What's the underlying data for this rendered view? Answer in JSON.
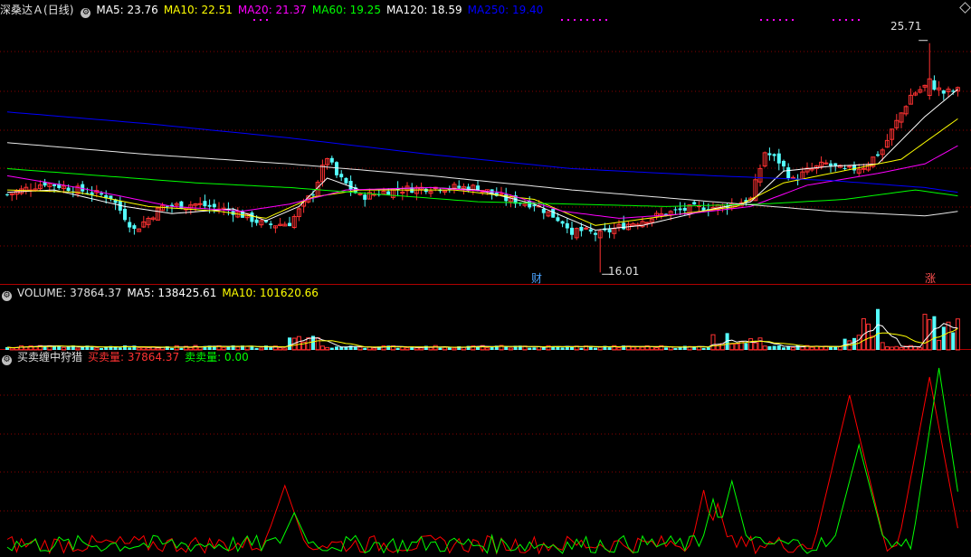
{
  "main_panel": {
    "stock_name": "深桑达Ａ",
    "period": "(日线)",
    "ma_legend": [
      {
        "text": "MA5: 23.76",
        "color": "#ffffff"
      },
      {
        "text": "MA10: 22.51",
        "color": "#ffff00"
      },
      {
        "text": "MA20: 21.37",
        "color": "#ff00ff"
      },
      {
        "text": "MA60: 19.25",
        "color": "#00ff00"
      },
      {
        "text": "MA120: 18.59",
        "color": "#ffffff"
      },
      {
        "text": "MA250: 19.40",
        "color": "#0000ff"
      }
    ],
    "high_label": "25.71",
    "low_label": "16.01",
    "marker_cai": "财",
    "marker_zhang": "涨"
  },
  "volume_panel": {
    "title": "VOLUME: 37864.37",
    "ma5": "MA5: 138425.61",
    "ma10": "MA10: 101620.66"
  },
  "indicator_panel": {
    "title": "买卖缠中狩猎",
    "buy": "买卖量: 37864.37",
    "sell": "卖卖量: 0.00"
  },
  "colors": {
    "up": "#ff3232",
    "down": "#54ffff",
    "ma5": "#ffffff",
    "ma10": "#ffff00",
    "ma20": "#ff00ff",
    "ma60": "#00ff00",
    "ma120": "#e8e8e8",
    "ma250": "#0000ff",
    "grid": "#8b0000",
    "buy_line": "#ff0000",
    "sell_line": "#00ff00"
  },
  "chart_data": [
    {
      "type": "candlestick",
      "title": "深桑达Ａ (日线)",
      "ylim": [
        15.6,
        27.0
      ],
      "high": 25.71,
      "low": 16.01,
      "anchors": [
        [
          0,
          19.3
        ],
        [
          8,
          19.8
        ],
        [
          15,
          19.5
        ],
        [
          22,
          19.2
        ],
        [
          27,
          17.8
        ],
        [
          33,
          18.8
        ],
        [
          40,
          18.9
        ],
        [
          48,
          18.6
        ],
        [
          55,
          18.0
        ],
        [
          60,
          18.1
        ],
        [
          65,
          19.4
        ],
        [
          68,
          20.9
        ],
        [
          70,
          20.1
        ],
        [
          75,
          19.2
        ],
        [
          82,
          19.5
        ],
        [
          90,
          19.6
        ],
        [
          100,
          19.6
        ],
        [
          106,
          19.1
        ],
        [
          112,
          18.9
        ],
        [
          116,
          18.4
        ],
        [
          121,
          17.8
        ],
        [
          126,
          17.6
        ],
        [
          131,
          18.0
        ],
        [
          140,
          18.5
        ],
        [
          145,
          18.7
        ],
        [
          152,
          18.8
        ],
        [
          158,
          19.1
        ],
        [
          161,
          21.1
        ],
        [
          164,
          20.7
        ],
        [
          167,
          19.9
        ],
        [
          170,
          20.3
        ],
        [
          174,
          20.6
        ],
        [
          178,
          20.3
        ],
        [
          182,
          20.5
        ],
        [
          186,
          21.2
        ],
        [
          188,
          22.0
        ],
        [
          192,
          23.5
        ],
        [
          196,
          24.0
        ],
        [
          199,
          23.6
        ],
        [
          202,
          23.7
        ]
      ],
      "ma_anchors": {
        "MA5": [
          [
            0,
            19.4
          ],
          [
            10,
            19.5
          ],
          [
            25,
            18.8
          ],
          [
            35,
            18.5
          ],
          [
            48,
            18.7
          ],
          [
            55,
            18.2
          ],
          [
            62,
            18.8
          ],
          [
            68,
            20.0
          ],
          [
            75,
            19.5
          ],
          [
            90,
            19.6
          ],
          [
            100,
            19.5
          ],
          [
            112,
            18.9
          ],
          [
            125,
            17.8
          ],
          [
            135,
            18.0
          ],
          [
            150,
            18.7
          ],
          [
            158,
            19.0
          ],
          [
            165,
            20.3
          ],
          [
            175,
            20.5
          ],
          [
            185,
            20.6
          ],
          [
            195,
            22.6
          ],
          [
            202,
            23.76
          ]
        ],
        "MA10": [
          [
            0,
            19.5
          ],
          [
            15,
            19.4
          ],
          [
            30,
            18.8
          ],
          [
            45,
            18.6
          ],
          [
            55,
            18.3
          ],
          [
            65,
            19.2
          ],
          [
            75,
            19.5
          ],
          [
            95,
            19.5
          ],
          [
            112,
            19.1
          ],
          [
            125,
            18.0
          ],
          [
            140,
            18.4
          ],
          [
            155,
            18.8
          ],
          [
            165,
            19.8
          ],
          [
            180,
            20.4
          ],
          [
            190,
            20.8
          ],
          [
            202,
            22.51
          ]
        ],
        "MA20": [
          [
            0,
            20.1
          ],
          [
            15,
            19.6
          ],
          [
            35,
            18.8
          ],
          [
            50,
            18.6
          ],
          [
            60,
            18.9
          ],
          [
            72,
            19.5
          ],
          [
            90,
            19.6
          ],
          [
            105,
            19.4
          ],
          [
            118,
            18.6
          ],
          [
            130,
            18.3
          ],
          [
            145,
            18.5
          ],
          [
            158,
            18.8
          ],
          [
            170,
            19.7
          ],
          [
            185,
            20.2
          ],
          [
            195,
            20.6
          ],
          [
            202,
            21.37
          ]
        ],
        "MA60": [
          [
            0,
            20.4
          ],
          [
            20,
            20.1
          ],
          [
            40,
            19.8
          ],
          [
            60,
            19.6
          ],
          [
            80,
            19.3
          ],
          [
            100,
            19.0
          ],
          [
            120,
            18.9
          ],
          [
            140,
            18.8
          ],
          [
            160,
            18.9
          ],
          [
            178,
            19.1
          ],
          [
            193,
            19.5
          ],
          [
            202,
            19.25
          ]
        ],
        "MA120": [
          [
            0,
            21.5
          ],
          [
            30,
            21.0
          ],
          [
            60,
            20.6
          ],
          [
            90,
            20.1
          ],
          [
            120,
            19.5
          ],
          [
            150,
            19.0
          ],
          [
            175,
            18.6
          ],
          [
            195,
            18.4
          ],
          [
            202,
            18.59
          ]
        ],
        "MA250": [
          [
            0,
            22.8
          ],
          [
            30,
            22.3
          ],
          [
            60,
            21.7
          ],
          [
            90,
            21.0
          ],
          [
            120,
            20.4
          ],
          [
            150,
            20.1
          ],
          [
            175,
            19.9
          ],
          [
            195,
            19.6
          ],
          [
            202,
            19.4
          ]
        ]
      }
    },
    {
      "type": "bar",
      "title": "VOLUME",
      "last_value": 37864.37,
      "ma5": 138425.61,
      "ma10": 101620.66
    },
    {
      "type": "line",
      "title": "买卖缠中狩猎",
      "series": [
        {
          "name": "买卖量",
          "last_value": 37864.37
        },
        {
          "name": "卖卖量",
          "last_value": 0.0
        }
      ]
    }
  ]
}
